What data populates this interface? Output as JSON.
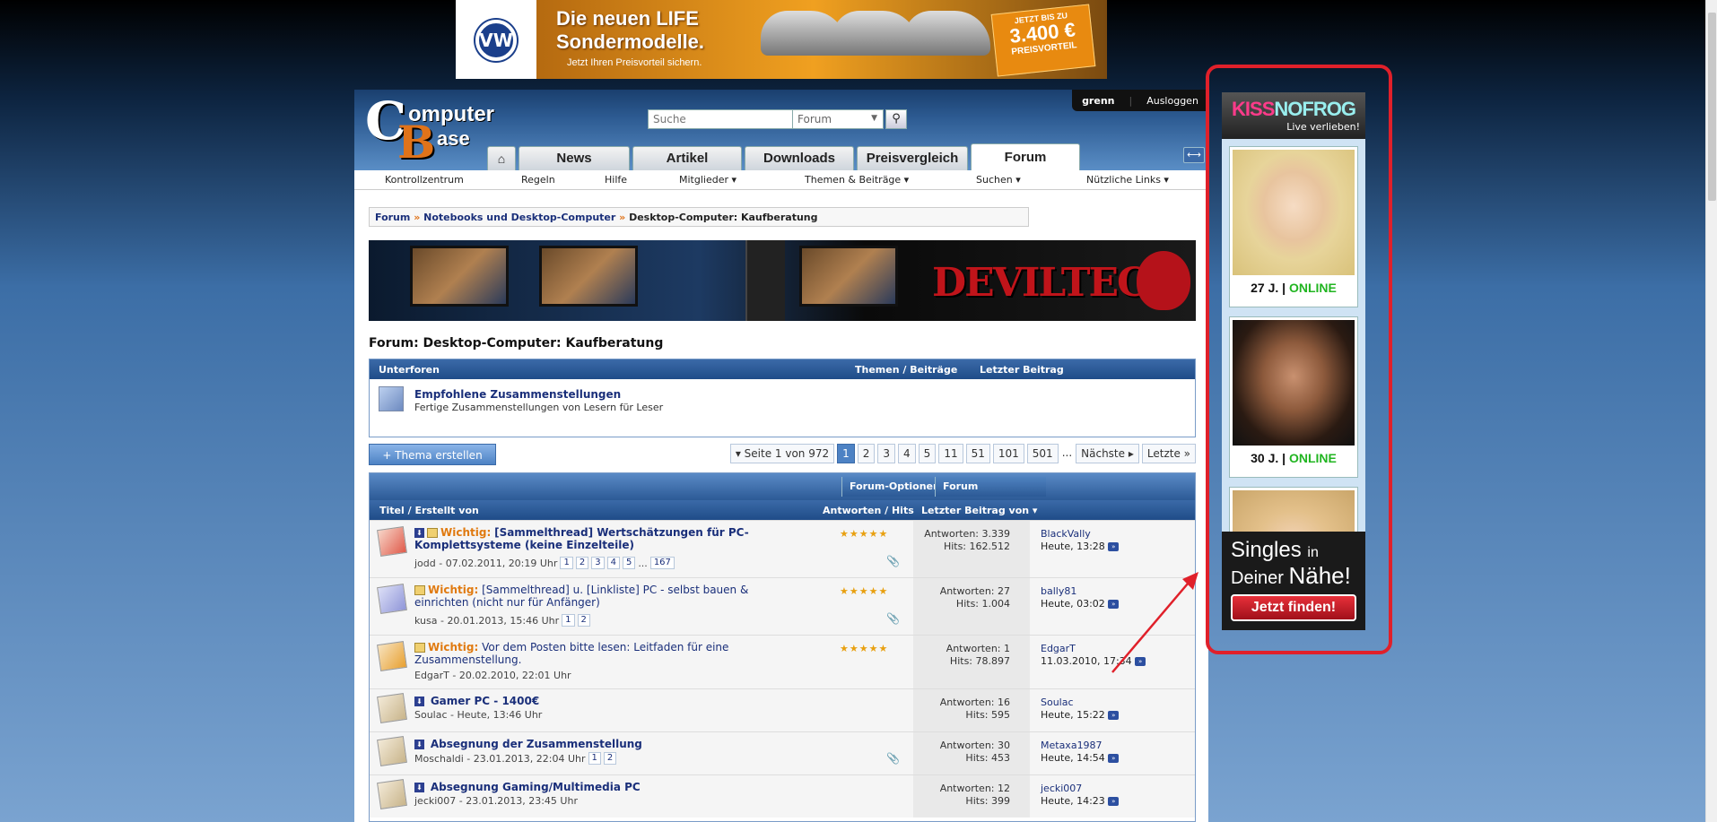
{
  "top_ad": {
    "logo": "VW",
    "headline_1": "Die neuen LIFE",
    "headline_2": "Sondermodelle.",
    "sub": "Jetzt Ihren Preisvorteil sichern.",
    "badge_1": "JETZT BIS ZU",
    "badge_2": "3.400 €",
    "badge_3": "PREISVORTEIL"
  },
  "logo": {
    "c": "C",
    "b": "B",
    "t1": "omputer",
    "t2": "ase"
  },
  "search": {
    "placeholder": "Suche",
    "scope": "Forum",
    "go_icon": "magnifier-icon"
  },
  "user": {
    "name": "grenn",
    "logout": "Ausloggen"
  },
  "tabs": {
    "home_icon": "⌂",
    "items": [
      "News",
      "Artikel",
      "Downloads",
      "Preisvergleich",
      "Forum"
    ]
  },
  "subnav": [
    "Kontrollzentrum",
    "Regeln",
    "Hilfe",
    "Mitglieder ▾",
    "Themen & Beiträge ▾",
    "Suchen ▾",
    "Nützliche Links ▾"
  ],
  "breadcrumb": [
    "Forum",
    "Notebooks und Desktop-Computer",
    "Desktop-Computer: Kaufberatung"
  ],
  "banner": {
    "brand": "DEVILTECH"
  },
  "forum_title": "Forum: Desktop-Computer: Kaufberatung",
  "subforum": {
    "header": {
      "col1": "Unterforen",
      "col2": "Themen / Beiträge",
      "col3": "Letzter Beitrag"
    },
    "title": "Empfohlene Zusammenstellungen",
    "desc": "Fertige Zusammenstellungen von Lesern für Leser"
  },
  "new_thread": "+ Thema erstellen",
  "pager": {
    "label": "Seite 1 von 972",
    "pages": [
      "1",
      "2",
      "3",
      "4",
      "5",
      "11",
      "51",
      "101",
      "501"
    ],
    "ellipsis": "...",
    "next": "Nächste",
    "last": "Letzte"
  },
  "options": {
    "forum_options": "Forum-Optionen ▾",
    "forum_search": "Forum durchsuchen ▾"
  },
  "thread_header": {
    "col1": "Titel / Erstellt von",
    "col2": "Antworten / Hits",
    "col3": "Letzter Beitrag von ▾"
  },
  "threads": [
    {
      "prefix": "Wichtig:",
      "title": "[Sammelthread] Wertschätzungen für PC-Komplettsysteme (keine Einzelteile)",
      "author": "jodd - 07.02.2011, 20:19 Uhr",
      "pages": [
        "1",
        "2",
        "3",
        "4",
        "5",
        "...",
        "167"
      ],
      "replies": "Antworten: 3.339",
      "hits": "Hits: 162.512",
      "last_user": "BlackVally",
      "last_time": "Heute, 13:28"
    },
    {
      "prefix": "Wichtig:",
      "title": "[Sammelthread] u. [Linkliste] PC - selbst bauen & einrichten (nicht nur für Anfänger)",
      "author": "kusa - 20.01.2013, 15:46 Uhr",
      "pages": [
        "1",
        "2"
      ],
      "replies": "Antworten: 27",
      "hits": "Hits: 1.004",
      "last_user": "bally81",
      "last_time": "Heute, 03:02"
    },
    {
      "prefix": "Wichtig:",
      "title": "Vor dem Posten bitte lesen: Leitfaden für eine Zusammenstellung.",
      "author": "EdgarT - 20.02.2010, 22:01 Uhr",
      "pages": [],
      "replies": "Antworten: 1",
      "hits": "Hits: 78.897",
      "last_user": "EdgarT",
      "last_time": "11.03.2010, 17:34"
    },
    {
      "prefix": "",
      "title": "Gamer PC - 1400€",
      "author": "Soulac - Heute, 13:46 Uhr",
      "pages": [],
      "replies": "Antworten: 16",
      "hits": "Hits: 595",
      "last_user": "Soulac",
      "last_time": "Heute, 15:22"
    },
    {
      "prefix": "",
      "title": "Absegnung der Zusammenstellung",
      "author": "Moschaldi - 23.01.2013, 22:04 Uhr",
      "pages": [
        "1",
        "2"
      ],
      "replies": "Antworten: 30",
      "hits": "Hits: 453",
      "last_user": "Metaxa1987",
      "last_time": "Heute, 14:54"
    },
    {
      "prefix": "",
      "title": "Absegnung Gaming/Multimedia PC",
      "author": "jecki007 - 23.01.2013, 23:45 Uhr",
      "pages": [],
      "replies": "Antworten: 12",
      "hits": "Hits: 399",
      "last_user": "jecki007",
      "last_time": "Heute, 14:23"
    }
  ],
  "side_ad": {
    "brand_kiss": "KISS",
    "brand_nofrog": "NOFROG",
    "tagline": "Live verlieben!",
    "profiles": [
      {
        "age": "27 J.",
        "status": "ONLINE"
      },
      {
        "age": "30 J.",
        "status": "ONLINE"
      }
    ],
    "cta_1": "Singles",
    "cta_1b": "in",
    "cta_2": "Deiner",
    "cta_2b": "Nähe!",
    "cta_button": "Jetzt finden!"
  },
  "colors": {
    "accent": "#e0731a",
    "nav_blue": "#1f4c88",
    "highlight_red": "#e0202a",
    "online_green": "#21b521"
  }
}
